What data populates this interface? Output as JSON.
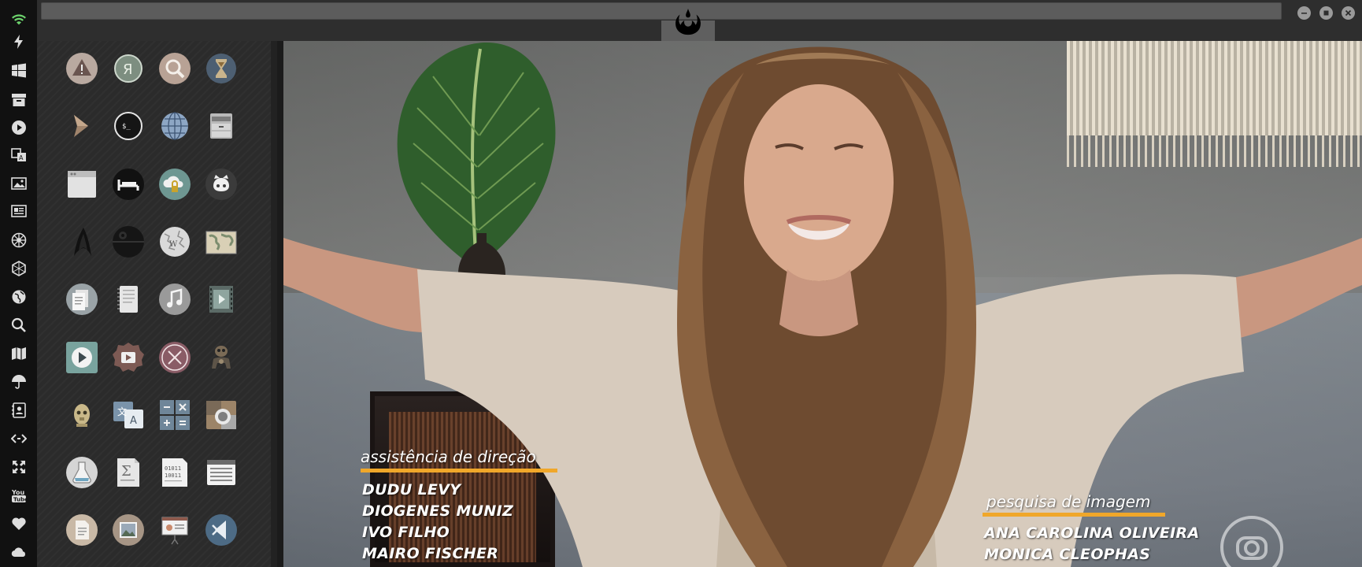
{
  "dock": {
    "items": [
      {
        "icon": "wifi-icon"
      },
      {
        "icon": "lightning-icon"
      },
      {
        "icon": "windows-icon"
      },
      {
        "icon": "archive-icon"
      },
      {
        "icon": "play-circle-icon"
      },
      {
        "icon": "translate-icon"
      },
      {
        "icon": "image-icon"
      },
      {
        "icon": "newspaper-icon"
      },
      {
        "icon": "empire-icon"
      },
      {
        "icon": "hexagon-icon"
      },
      {
        "icon": "globe-icon"
      },
      {
        "icon": "search-icon"
      },
      {
        "icon": "map-icon"
      },
      {
        "icon": "umbrella-icon"
      },
      {
        "icon": "contact-book-icon"
      },
      {
        "icon": "code-icon"
      },
      {
        "icon": "expand-icon"
      },
      {
        "icon": "youtube-icon"
      },
      {
        "icon": "heart-icon"
      },
      {
        "icon": "cloud-icon"
      }
    ]
  },
  "window": {
    "emblem_icon": "rebel-alliance-icon",
    "controls": [
      "minimize-icon",
      "maximize-icon",
      "close-icon"
    ]
  },
  "apps": [
    [
      "warning-app-icon",
      "yandex-app-icon",
      "search-app-icon",
      "hourglass-app-icon"
    ],
    [
      "terminal-chevron-app-icon",
      "shell-app-icon",
      "web-browser-app-icon",
      "file-cabinet-app-icon"
    ],
    [
      "window-app-icon",
      "bed-app-icon",
      "cloud-lock-app-icon",
      "github-app-icon"
    ],
    [
      "starfleet-app-icon",
      "death-star-app-icon",
      "wikipedia-app-icon",
      "world-map-app-icon"
    ],
    [
      "documents-app-icon",
      "notebook-app-icon",
      "music-app-icon",
      "video-app-icon"
    ],
    [
      "media-player-app-icon",
      "video-capture-app-icon",
      "xchat-app-icon",
      "droid-app-icon"
    ],
    [
      "c3po-app-icon",
      "translator-app-icon",
      "calculator-app-icon",
      "camera-app-icon"
    ],
    [
      "chemistry-app-icon",
      "formula-app-icon",
      "binary-app-icon",
      "spreadsheet-app-icon"
    ],
    [
      "text-document-app-icon",
      "image-viewer-app-icon",
      "presentation-app-icon",
      "vscode-app-icon"
    ]
  ],
  "video": {
    "credits_left": {
      "heading": "assistência de direção",
      "names": [
        "DUDU LEVY",
        "DIOGENES MUNIZ",
        "IVO FILHO",
        "MAIRO FISCHER"
      ]
    },
    "credits_right": {
      "heading": "pesquisa de imagem",
      "names": [
        "ANA CAROLINA OLIVEIRA",
        "MONICA CLEOPHAS"
      ]
    },
    "accent_color": "#f0a72a"
  }
}
